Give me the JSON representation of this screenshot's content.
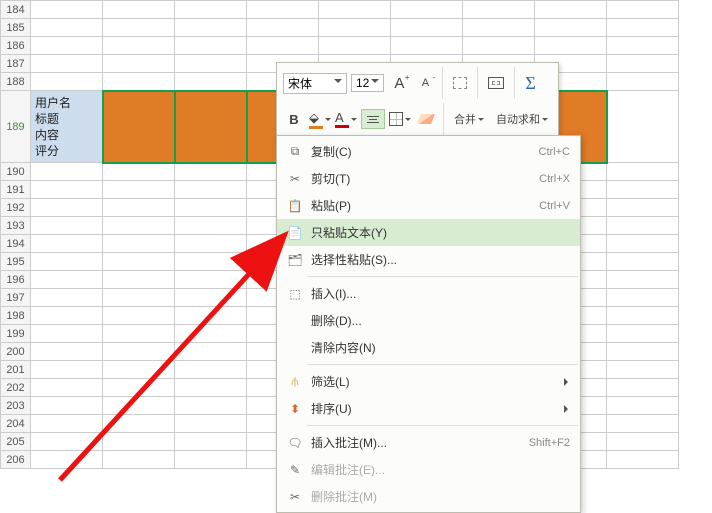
{
  "rows_before": [
    "184",
    "185",
    "186",
    "187",
    "188"
  ],
  "merged_row": "189",
  "rows_after": [
    "190",
    "191",
    "192",
    "193",
    "194",
    "195",
    "196",
    "197",
    "198",
    "199",
    "200",
    "201",
    "202",
    "203",
    "204",
    "205",
    "206"
  ],
  "cell_lines": [
    "用户名",
    "标题",
    "内容",
    "评分"
  ],
  "toolbar": {
    "font_name": "宋体",
    "font_size": "12",
    "merge_label": "合并",
    "autosum_label": "自动求和"
  },
  "menu": {
    "copy": "复制(C)",
    "cut": "剪切(T)",
    "paste": "粘贴(P)",
    "paste_text": "只粘贴文本(Y)",
    "paste_special": "选择性粘贴(S)...",
    "insert": "插入(I)...",
    "delete": "删除(D)...",
    "clear": "清除内容(N)",
    "filter": "筛选(L)",
    "sort": "排序(U)",
    "insert_comment": "插入批注(M)...",
    "edit_comment": "编辑批注(E)...",
    "delete_comment": "删除批注(M)",
    "sc_copy": "Ctrl+C",
    "sc_cut": "Ctrl+X",
    "sc_paste": "Ctrl+V",
    "sc_comment": "Shift+F2"
  }
}
